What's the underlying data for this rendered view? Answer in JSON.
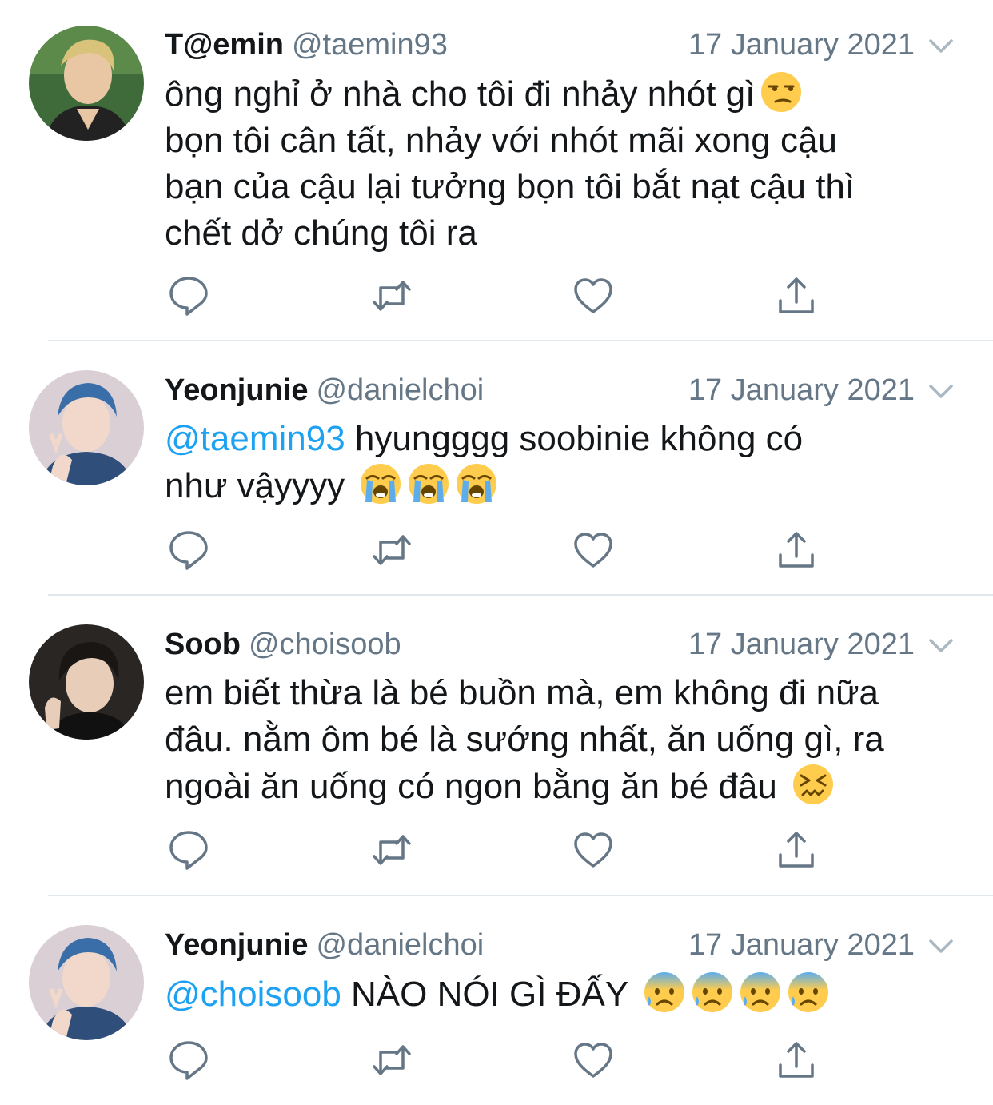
{
  "tweets": [
    {
      "name": "T@emin",
      "handle": "@taemin93",
      "date": "17 January 2021",
      "mention": "",
      "lines": [
        "ông nghỉ ở nhà cho tôi đi nhảy nhót gì",
        "bọn tôi cân tất, nhảy với nhót mãi xong cậu",
        "bạn của cậu lại tưởng bọn tôi bắt nạt cậu thì",
        "chết dở chúng tôi ra"
      ],
      "emoji_after_first_line": [
        "unamused-face"
      ]
    },
    {
      "name": "Yeonjunie",
      "handle": "@danielchoi",
      "date": "17 January 2021",
      "mention": "@taemin93",
      "lines": [
        "hyungggg soobinie không có",
        "như vậyyyy"
      ],
      "emojis": [
        "loudly-crying-face",
        "loudly-crying-face",
        "loudly-crying-face"
      ]
    },
    {
      "name": "Soob",
      "handle": "@choisoob",
      "date": "17 January 2021",
      "mention": "",
      "lines": [
        "em biết thừa là bé buồn mà, em không đi nữa",
        "đâu. nằm ôm bé là sướng nhất, ăn uống gì, ra",
        "ngoài ăn uống có ngon bằng ăn bé đâu"
      ],
      "emojis": [
        "confounded-face"
      ]
    },
    {
      "name": "Yeonjunie",
      "handle": "@danielchoi",
      "date": "17 January 2021",
      "mention": "@choisoob",
      "lines": [
        "NÀO NÓI GÌ ĐẤY"
      ],
      "emojis": [
        "anxious-face-with-sweat",
        "anxious-face-with-sweat",
        "anxious-face-with-sweat",
        "anxious-face-with-sweat"
      ]
    }
  ],
  "icons": {
    "reply": "reply-icon",
    "retweet": "retweet-icon",
    "like": "like-icon",
    "share": "share-icon",
    "caret": "chevron-down-icon"
  },
  "colors": {
    "text": "#14171a",
    "secondary": "#657786",
    "mention": "#1da1f2",
    "divider": "#e1e8ed"
  }
}
